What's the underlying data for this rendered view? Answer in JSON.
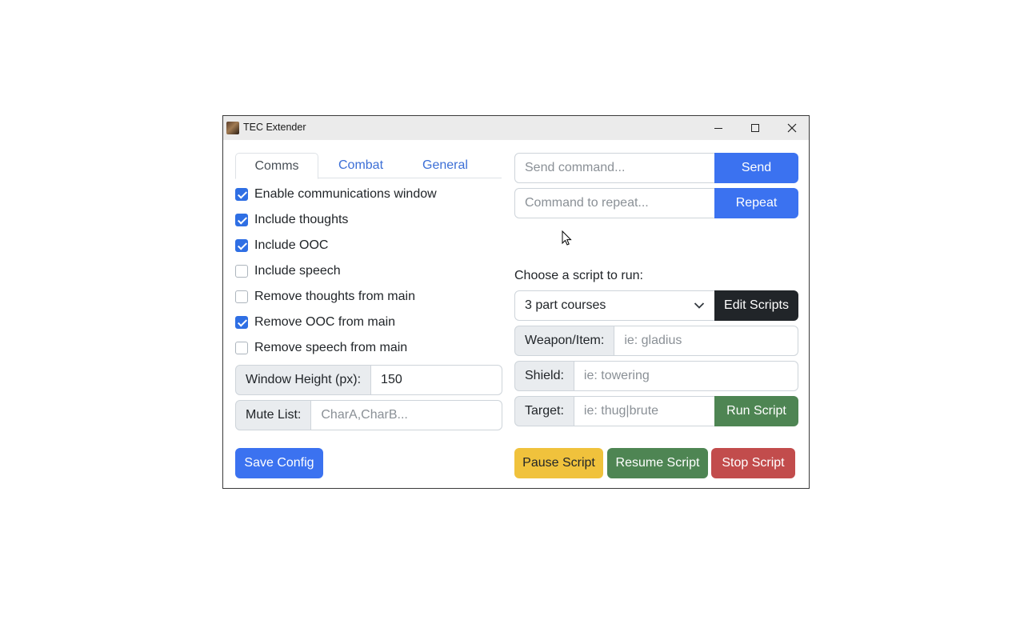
{
  "window": {
    "title": "TEC Extender"
  },
  "tabs": [
    {
      "label": "Comms",
      "active": true
    },
    {
      "label": "Combat",
      "active": false
    },
    {
      "label": "General",
      "active": false
    }
  ],
  "comms": {
    "options": [
      {
        "label": "Enable communications window",
        "checked": true
      },
      {
        "label": "Include thoughts",
        "checked": true
      },
      {
        "label": "Include OOC",
        "checked": true
      },
      {
        "label": "Include speech",
        "checked": false
      },
      {
        "label": "Remove thoughts from main",
        "checked": false
      },
      {
        "label": "Remove OOC from main",
        "checked": true
      },
      {
        "label": "Remove speech from main",
        "checked": false
      }
    ],
    "window_height_label": "Window Height (px):",
    "window_height_value": "150",
    "mute_list_label": "Mute List:",
    "mute_list_placeholder": "CharA,CharB..."
  },
  "save_config_label": "Save Config",
  "command": {
    "send_placeholder": "Send command...",
    "send_label": "Send",
    "repeat_placeholder": "Command to repeat...",
    "repeat_label": "Repeat"
  },
  "script": {
    "choose_label": "Choose a script to run:",
    "selected": "3 part courses",
    "edit_label": "Edit Scripts",
    "weapon_label": "Weapon/Item:",
    "weapon_placeholder": "ie: gladius",
    "shield_label": "Shield:",
    "shield_placeholder": "ie: towering",
    "target_label": "Target:",
    "target_placeholder": "ie: thug|brute",
    "run_label": "Run Script",
    "pause_label": "Pause Script",
    "resume_label": "Resume Script",
    "stop_label": "Stop Script"
  },
  "colors": {
    "primary": "#3b72f0",
    "dark": "#212529",
    "success": "#4e8553",
    "warning": "#f0c23c",
    "danger": "#c24c4c"
  }
}
